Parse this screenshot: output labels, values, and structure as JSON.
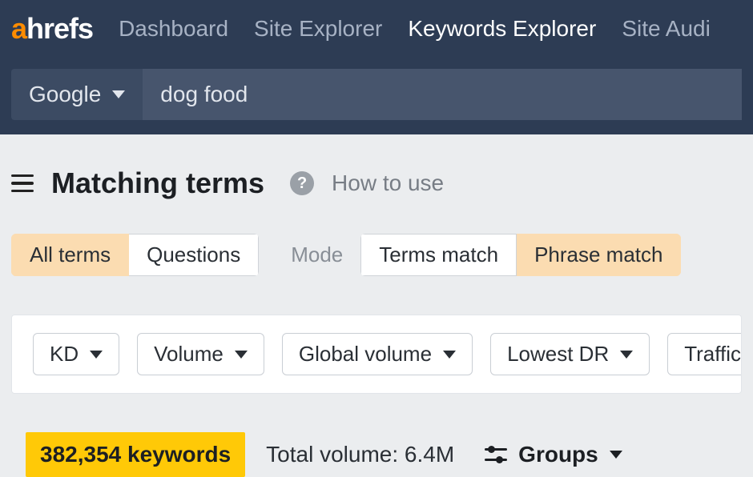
{
  "logo": {
    "a": "a",
    "rest": "hrefs"
  },
  "nav": {
    "dashboard": "Dashboard",
    "site_explorer": "Site Explorer",
    "keywords_explorer": "Keywords Explorer",
    "site_audit": "Site Audi"
  },
  "search": {
    "engine": "Google",
    "query": "dog food"
  },
  "page": {
    "title": "Matching terms",
    "how_to_use": "How to use"
  },
  "tabs": {
    "all_terms": "All terms",
    "questions": "Questions",
    "mode_label": "Mode",
    "terms_match": "Terms match",
    "phrase_match": "Phrase match"
  },
  "filters": {
    "kd": "KD",
    "volume": "Volume",
    "global_volume": "Global volume",
    "lowest_dr": "Lowest DR",
    "traffic": "Traffic"
  },
  "results": {
    "keywords_badge": "382,354 keywords",
    "total_volume": "Total volume: 6.4M",
    "groups": "Groups"
  }
}
